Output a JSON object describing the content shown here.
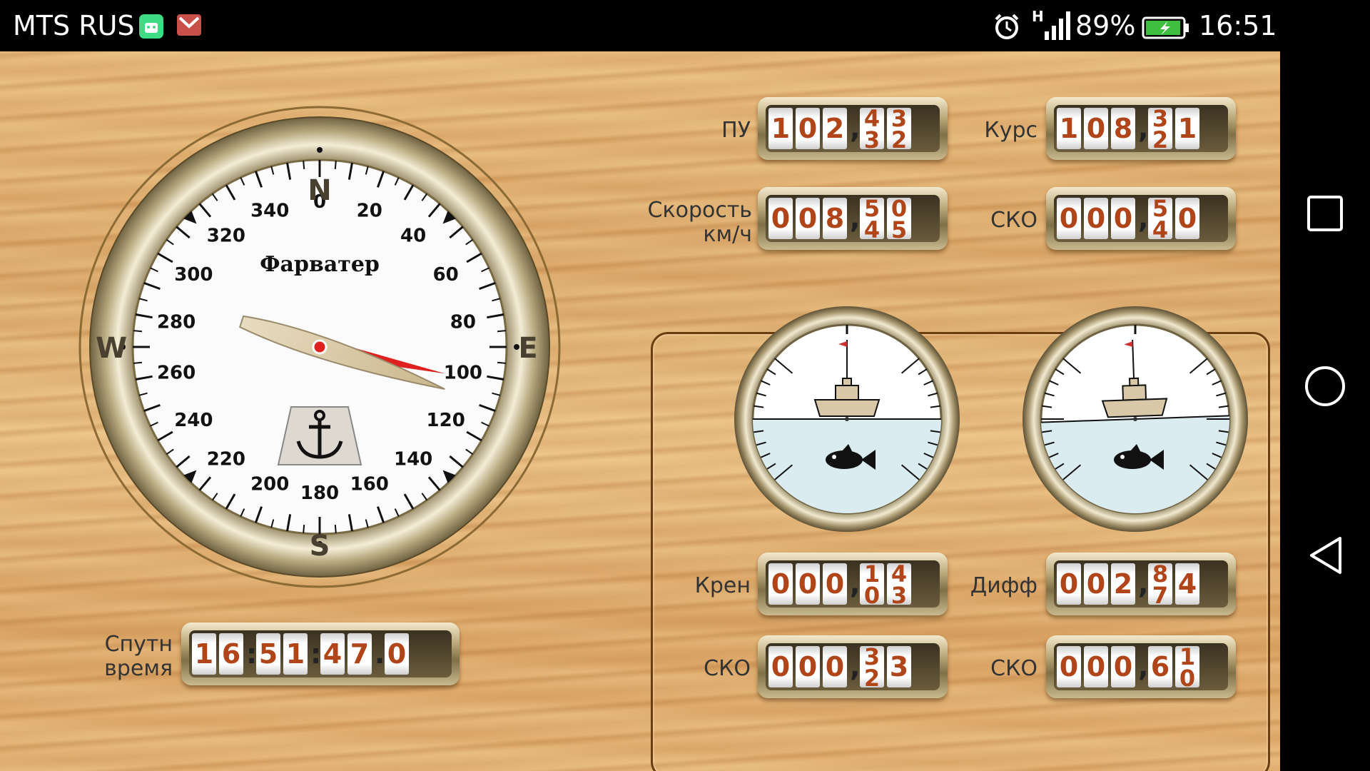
{
  "status_bar": {
    "carrier": "MTS RUS",
    "notification_icons": [
      "android-icon",
      "gmail-icon"
    ],
    "right_icons": [
      "alarm-icon",
      "signal-icon",
      "battery-icon"
    ],
    "network_letter": "H",
    "battery_percent": "89%",
    "time": "16:51"
  },
  "compass": {
    "logo": "Фарватер",
    "cardinal": {
      "n": "N",
      "e": "E",
      "s": "S",
      "w": "W"
    },
    "degree_labels": [
      "0",
      "20",
      "40",
      "60",
      "80",
      "100",
      "120",
      "140",
      "160",
      "180",
      "200",
      "220",
      "240",
      "260",
      "280",
      "300",
      "320",
      "340"
    ],
    "heading_deg": 108,
    "course_deg": 102,
    "anchor_icon": "anchor-icon"
  },
  "readouts": {
    "pu": {
      "label": "ПУ",
      "digits": [
        "1",
        "0",
        "2"
      ],
      "sep": ",",
      "rolling": [
        "4/3",
        "3/2"
      ]
    },
    "kurs": {
      "label": "Курс",
      "digits": [
        "1",
        "0",
        "8"
      ],
      "sep": ",",
      "rolling": [
        "3/2",
        "1"
      ]
    },
    "speed": {
      "label_line1": "Скорость",
      "label_line2": "км/ч",
      "digits": [
        "0",
        "0",
        "8"
      ],
      "sep": ",",
      "rolling": [
        "5/4",
        "0/5"
      ]
    },
    "sko1": {
      "label": "СКО",
      "digits": [
        "0",
        "0",
        "0"
      ],
      "sep": ",",
      "rolling": [
        "5/4",
        "0"
      ]
    },
    "kren": {
      "label": "Крен",
      "digits": [
        "0",
        "0",
        "0"
      ],
      "sep": ",",
      "rolling": [
        "1/0",
        "4/3"
      ]
    },
    "diff": {
      "label": "Дифф",
      "digits": [
        "0",
        "0",
        "2"
      ],
      "sep": ",",
      "rolling": [
        "8/7",
        "4"
      ]
    },
    "sko2": {
      "label": "СКО",
      "digits": [
        "0",
        "0",
        "0"
      ],
      "sep": ",",
      "rolling": [
        "3/2",
        "3"
      ]
    },
    "sko3": {
      "label": "СКО",
      "digits": [
        "0",
        "0",
        "0"
      ],
      "sep": ",",
      "rolling": [
        "6",
        "1/0"
      ]
    },
    "sat_time": {
      "label_line1": "Спутн",
      "label_line2": "время",
      "chars": [
        "1",
        "6",
        ":",
        "5",
        "1",
        ":",
        "4",
        "7",
        ".",
        "0"
      ]
    }
  },
  "gauges": {
    "roll": {
      "icon_ship": "ship-icon",
      "icon_fish": "fish-icon"
    },
    "pitch": {
      "icon_ship": "ship-icon",
      "icon_fish": "fish-icon"
    }
  },
  "nav_bar": {
    "buttons": [
      "recents-button",
      "home-button",
      "back-button"
    ]
  },
  "colors": {
    "counter_digit": "#b0451a",
    "needle": "#e0201e",
    "bezel": "#b4a67c"
  }
}
